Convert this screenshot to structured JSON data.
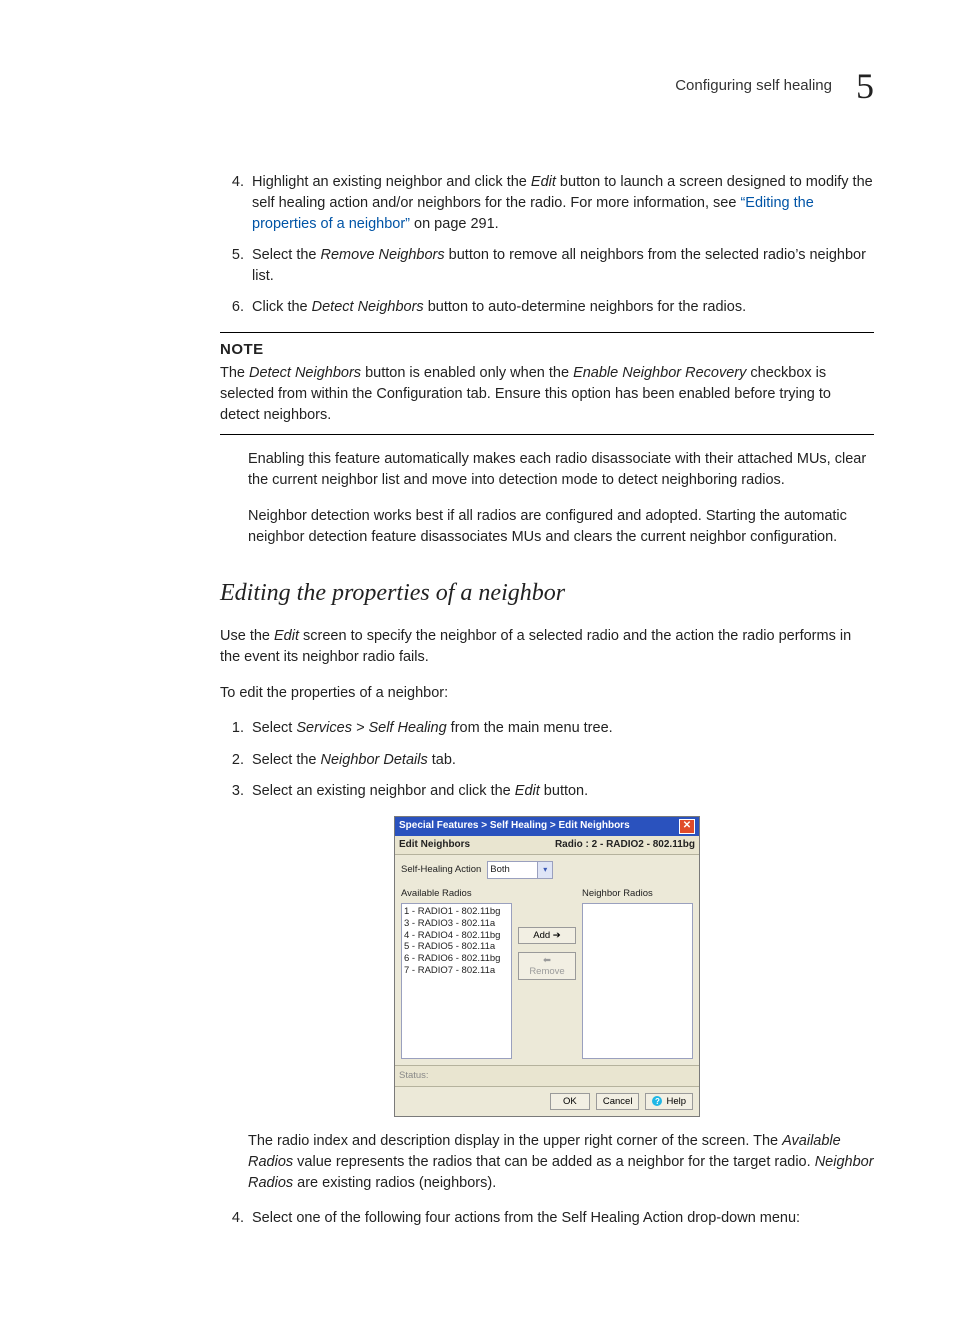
{
  "header": {
    "running_head": "Configuring self healing",
    "chapter_number": "5"
  },
  "list1": {
    "start": 4,
    "items": [
      {
        "pre": "Highlight an existing neighbor and click the ",
        "em1": "Edit",
        "mid": " button to launch a screen designed to modify the self healing action and/or neighbors for the radio. For more information, see ",
        "link": "“Editing the properties of a neighbor”",
        "post": " on page 291."
      },
      {
        "pre": "Select the ",
        "em1": "Remove Neighbors",
        "post": " button to remove all neighbors from the selected radio’s neighbor list."
      },
      {
        "pre": "Click the ",
        "em1": "Detect Neighbors",
        "post": " button to auto-determine neighbors for the radios."
      }
    ]
  },
  "note": {
    "label": "NOTE",
    "pre": "The ",
    "em1": "Detect Neighbors",
    "mid": " button is enabled only when the ",
    "em2": "Enable Neighbor Recovery",
    "post": " checkbox is selected from within the Configuration tab. Ensure this option has been enabled before trying to detect neighbors."
  },
  "paras": {
    "p1": "Enabling this feature automatically makes each radio disassociate with their attached MUs, clear the current neighbor list and move into detection mode to detect neighboring radios.",
    "p2": "Neighbor detection works best if all radios are configured and adopted. Starting the automatic neighbor detection feature disassociates MUs and clears the current neighbor configuration."
  },
  "section": {
    "title": "Editing the properties of a neighbor"
  },
  "intro": {
    "pre": "Use the ",
    "em1": "Edit",
    "post": " screen to specify the neighbor of a selected radio and the action the radio performs in the event its neighbor radio fails."
  },
  "lead": "To edit the properties of a neighbor:",
  "list2": {
    "start": 1,
    "items": [
      {
        "pre": "Select ",
        "em1": "Services > Self Healing",
        "post": " from the main menu tree."
      },
      {
        "pre": "Select the ",
        "em1": "Neighbor Details",
        "post": " tab."
      },
      {
        "pre": "Select an existing neighbor and click the ",
        "em1": "Edit",
        "post": " button."
      }
    ]
  },
  "shot": {
    "breadcrumb": "Special Features > Self Healing > Edit Neighbors",
    "close_x": "✕",
    "panel_title": "Edit Neighbors",
    "radio_label": "Radio : 2 - RADIO2 - 802.11bg",
    "action_label": "Self-Healing Action",
    "action_value": "Both",
    "available_label": "Available Radios",
    "neighbor_label": "Neighbor Radios",
    "available": [
      "1 - RADIO1 - 802.11bg",
      "3 - RADIO3 - 802.11a",
      "4 - RADIO4 - 802.11bg",
      "5 - RADIO5 - 802.11a",
      "6 - RADIO6 - 802.11bg",
      "7 - RADIO7 - 802.11a"
    ],
    "add_btn": "Add ➔",
    "remove_btn": "⬅ Remove",
    "status_label": "Status:",
    "ok": "OK",
    "cancel": "Cancel",
    "help": "Help"
  },
  "after_shot": {
    "pre": "The radio index and description display in the upper right corner of the screen. The ",
    "em1": "Available Radios",
    "mid": " value represents the radios that can be added as a neighbor for the target radio. ",
    "em2": "Neighbor Radios",
    "post": " are existing radios (neighbors)."
  },
  "list3": {
    "start": 4,
    "item": "Select one of the following four actions from the Self Healing Action drop-down menu:"
  }
}
